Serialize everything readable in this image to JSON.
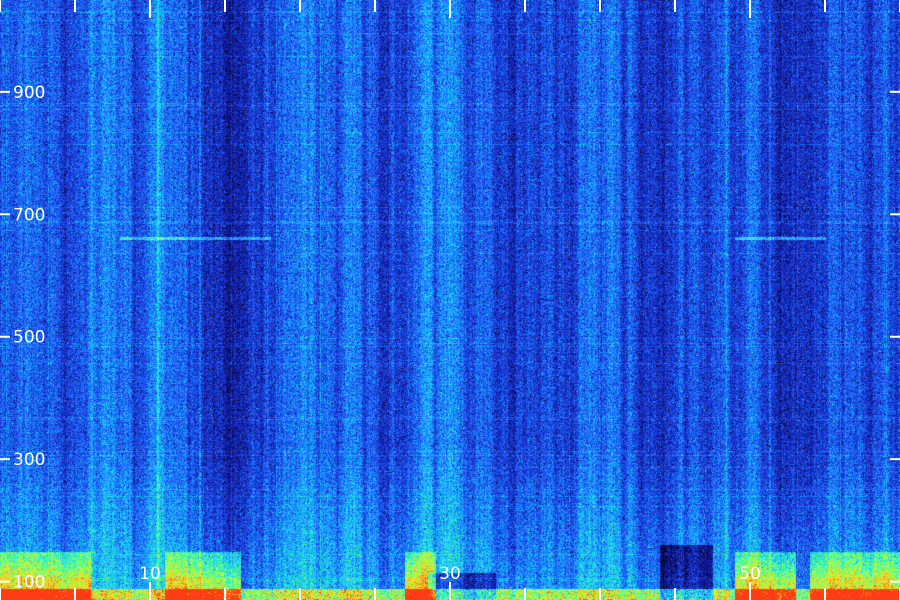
{
  "chart_data": {
    "type": "heatmap",
    "title": "",
    "xlabel": "",
    "ylabel": "",
    "x_ticks": {
      "major_values": [
        10,
        30,
        50
      ],
      "major_labels": [
        "10",
        "30",
        "50"
      ],
      "all_values": [
        0,
        5,
        10,
        15,
        20,
        25,
        30,
        35,
        40,
        45,
        50,
        55,
        60
      ]
    },
    "y_ticks": {
      "values": [
        100,
        300,
        500,
        700,
        900
      ],
      "labels": [
        "100",
        "300",
        "500",
        "700",
        "900"
      ]
    },
    "xlim": [
      0,
      60
    ],
    "ylim": [
      70,
      1050
    ],
    "colormap": [
      "#000000",
      "#0a0f6e",
      "#1a2bc8",
      "#1e6bff",
      "#19c6ff",
      "#33ffb4",
      "#b4ff3c",
      "#ffd21e",
      "#ff3c14"
    ],
    "features": [
      {
        "kind": "high-energy-band",
        "y_range": [
          70,
          150
        ],
        "x_segments": [
          [
            0,
            6
          ],
          [
            11,
            16
          ],
          [
            27,
            29
          ],
          [
            49,
            53
          ],
          [
            54,
            60
          ]
        ]
      },
      {
        "kind": "horizontal-line",
        "y": 662,
        "x_range": [
          8,
          18
        ]
      },
      {
        "kind": "horizontal-line",
        "y": 662,
        "x_range": [
          49,
          55
        ]
      },
      {
        "kind": "vertical-line",
        "x": 13.3
      },
      {
        "kind": "vertical-line",
        "x": 51.3
      },
      {
        "kind": "dark-gap",
        "x_range": [
          44,
          47.5
        ],
        "y_range": [
          70,
          160
        ]
      },
      {
        "kind": "dark-gap",
        "x_range": [
          28.5,
          33
        ],
        "y_range": [
          70,
          115
        ]
      }
    ]
  }
}
